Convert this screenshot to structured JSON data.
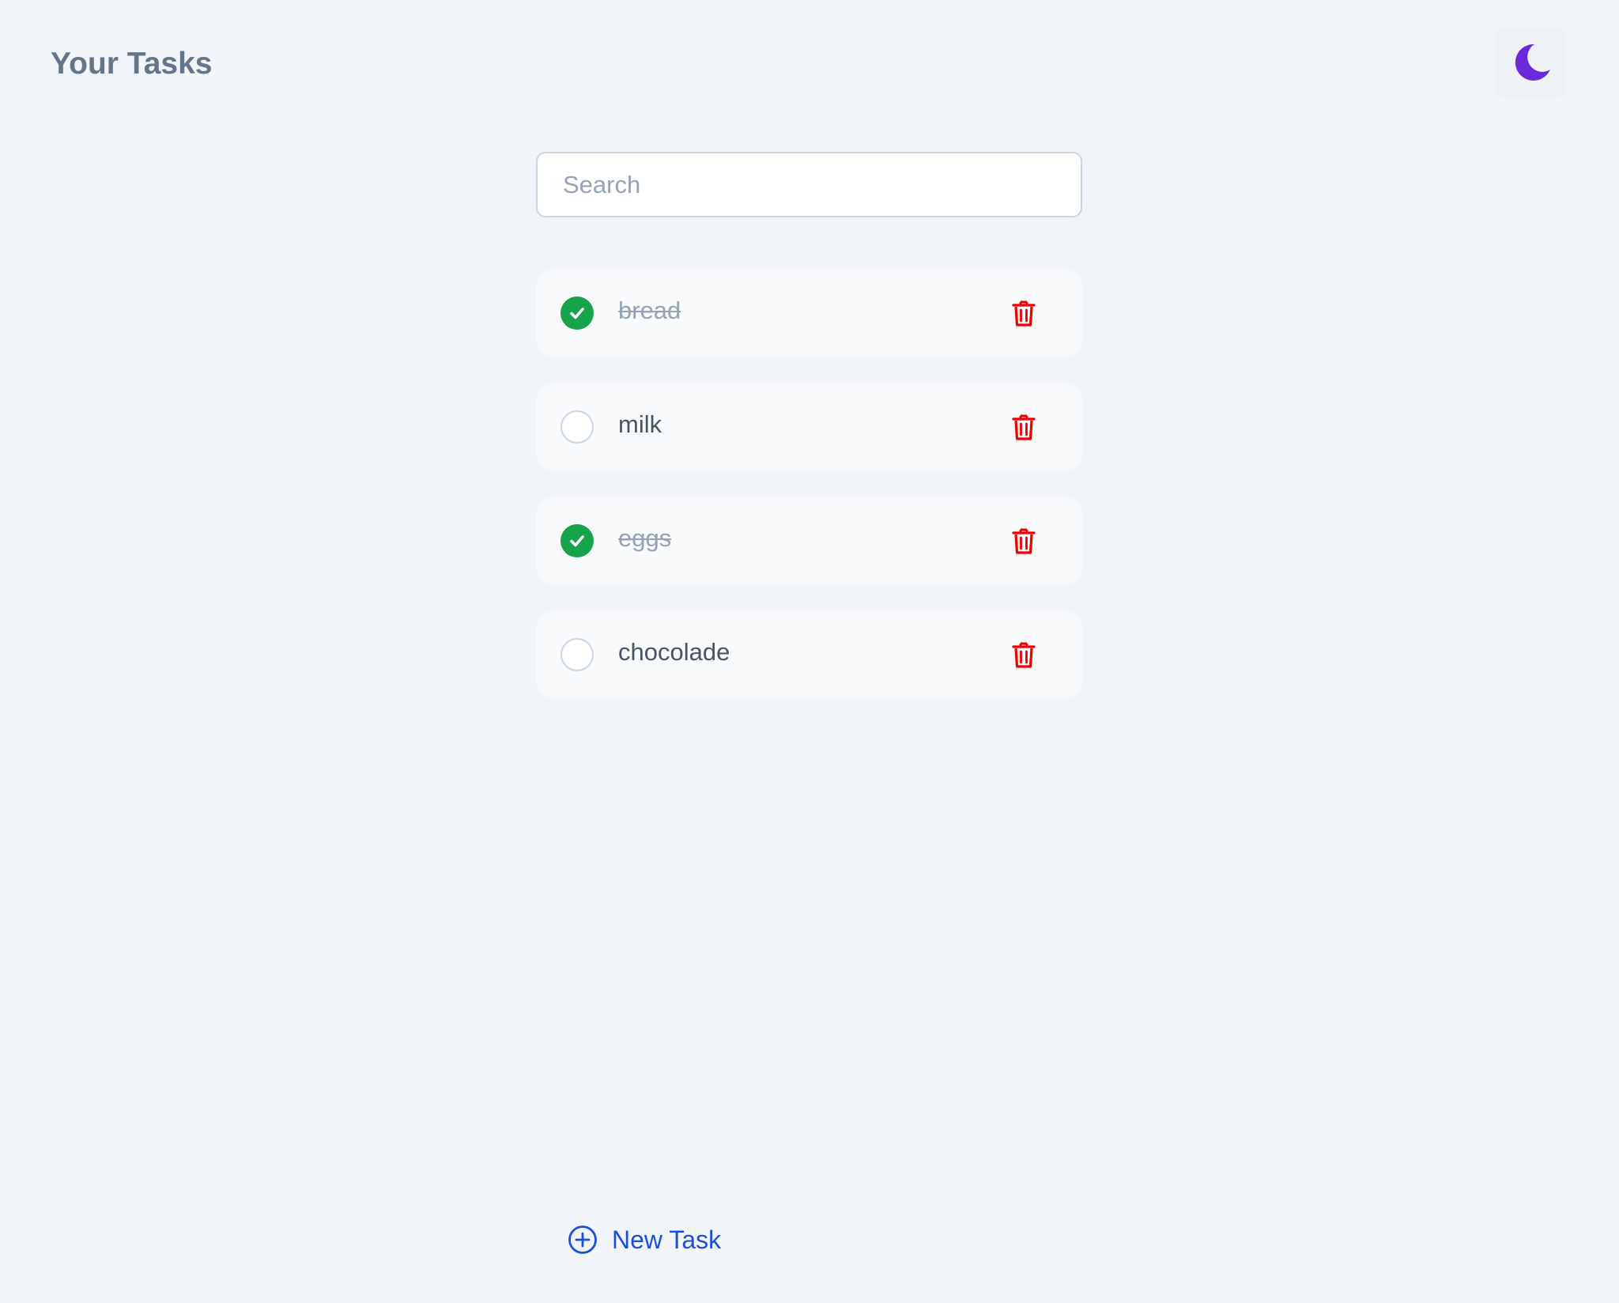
{
  "header": {
    "title": "Your Tasks",
    "theme_toggle_icon": "moon-icon",
    "accent_color": "#6d28d9"
  },
  "search": {
    "placeholder": "Search",
    "value": ""
  },
  "tasks": [
    {
      "label": "bread",
      "done": true
    },
    {
      "label": "milk",
      "done": false
    },
    {
      "label": "eggs",
      "done": true
    },
    {
      "label": "chocolade",
      "done": false
    }
  ],
  "icons": {
    "done": "check-circle-icon",
    "not_done": "circle-icon",
    "delete": "trash-icon",
    "add": "plus-circle-icon"
  },
  "colors": {
    "done_green": "#16a34a",
    "delete_red": "#ef0000",
    "link_blue": "#1d4ed8"
  },
  "footer": {
    "new_task_label": "New Task"
  }
}
